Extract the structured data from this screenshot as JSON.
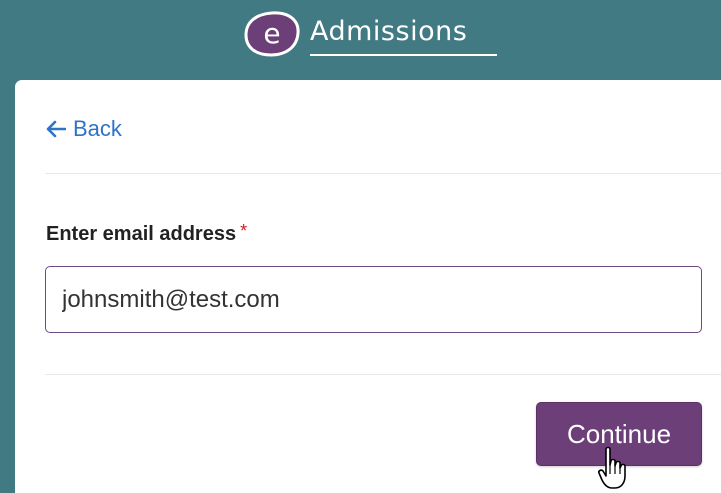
{
  "header": {
    "logo_letter": "e",
    "logo_text": "Admissions",
    "colors": {
      "background": "#417a82",
      "logo_badge": "#6c3f78"
    }
  },
  "card": {
    "back_label": "Back",
    "back_icon": "arrow-left-icon",
    "email_label": "Enter email address",
    "required_marker": "*",
    "email_value": "johnsmith@test.com",
    "continue_label": "Continue",
    "colors": {
      "link": "#2f73c8",
      "button": "#6c3f78",
      "required": "#d01c1c",
      "input_border": "#6e4a85"
    }
  },
  "pointer": {
    "icon": "hand-pointer-icon"
  }
}
